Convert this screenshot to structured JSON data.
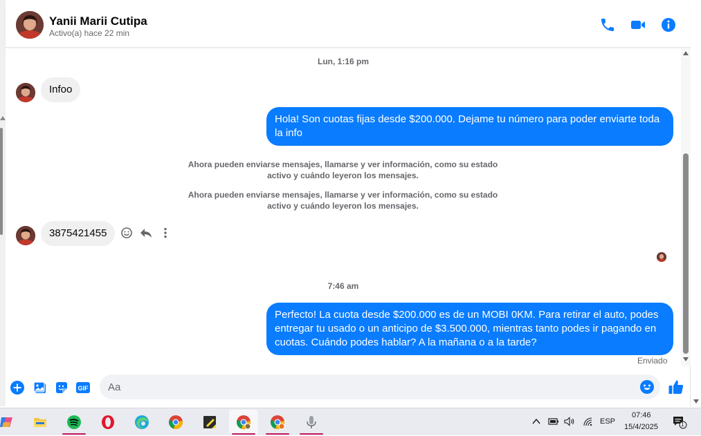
{
  "contact": {
    "name": "Yanii Marii Cutipa",
    "status": "Activo(a) hace 22 min"
  },
  "header_icons": [
    "phone-icon",
    "video-call-icon",
    "info-icon"
  ],
  "messages": {
    "timestamp_1": "Lun, 1:16 pm",
    "incoming_1": "Infoo",
    "outgoing_1": "Hola! Son cuotas fijas desde $200.000. Dejame tu número para poder enviarte toda la info",
    "system_1": "Ahora pueden enviarse mensajes, llamarse y ver información, como su estado activo y cuándo leyeron los mensajes.",
    "system_2": "Ahora pueden enviarse mensajes, llamarse y ver información, como su estado activo y cuándo leyeron los mensajes.",
    "incoming_2": "3875421455",
    "timestamp_2": "7:46 am",
    "outgoing_2": "Perfecto! La cuota desde $200.000 es de un MOBI 0KM. Para retirar el auto, podes entregar tu usado o un anticipo de $3.500.000, mientras tanto podes ir pagando en cuotas. Cuándo podes hablar? A la mañana o a la tarde?",
    "sent_status": "Enviado"
  },
  "composer": {
    "placeholder": "Aa",
    "gif_label": "GIF"
  },
  "taskbar": {
    "lang": "ESP",
    "time": "07:46",
    "date": "15/4/2025",
    "notification_count": "1"
  },
  "colors": {
    "accent": "#0a7cff",
    "bubble_in": "#f0f0f0"
  }
}
